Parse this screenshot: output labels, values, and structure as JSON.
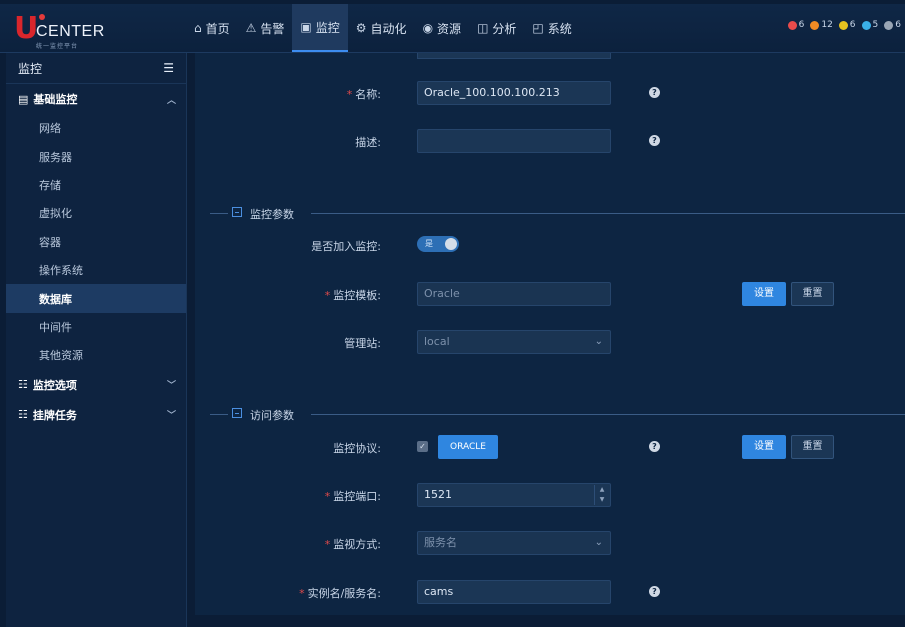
{
  "logo": {
    "mark": "U",
    "text": "CENTER",
    "sub": "统一监控平台"
  },
  "nav": [
    {
      "icon": "⌂",
      "label": "首页"
    },
    {
      "icon": "⚠",
      "label": "告警"
    },
    {
      "icon": "▣",
      "label": "监控"
    },
    {
      "icon": "⚙",
      "label": "自动化"
    },
    {
      "icon": "◉",
      "label": "资源"
    },
    {
      "icon": "◫",
      "label": "分析"
    },
    {
      "icon": "◰",
      "label": "系统"
    }
  ],
  "alerts": [
    {
      "count": "6",
      "color": "#e84b4b"
    },
    {
      "count": "12",
      "color": "#f08a24"
    },
    {
      "count": "6",
      "color": "#e6c21f"
    },
    {
      "count": "5",
      "color": "#3ab0e8"
    },
    {
      "count": "6",
      "color": "#9aa6b5"
    }
  ],
  "sidebar": {
    "title": "监控",
    "groups": [
      {
        "label": "基础监控",
        "items": [
          "网络",
          "服务器",
          "存储",
          "虚拟化",
          "容器",
          "操作系统",
          "数据库",
          "中间件",
          "其他资源"
        ]
      },
      {
        "label": "监控选项"
      },
      {
        "label": "挂牌任务"
      }
    ]
  },
  "form": {
    "name_label": "名称:",
    "name_value": "Oracle_100.100.100.213",
    "desc_label": "描述:",
    "desc_value": "",
    "section_monitor": "监控参数",
    "join_label": "是否加入监控:",
    "join_toggle": "是",
    "template_label": "监控模板:",
    "template_value": "Oracle",
    "station_label": "管理站:",
    "station_value": "local",
    "section_access": "访问参数",
    "protocol_label": "监控协议:",
    "protocol_tag": "ORACLE",
    "port_label": "监控端口:",
    "port_value": "1521",
    "method_label": "监视方式:",
    "method_value": "服务名",
    "instance_label": "实例名/服务名:",
    "instance_value": "cams",
    "set_label": "设置",
    "reset_label": "重置"
  }
}
